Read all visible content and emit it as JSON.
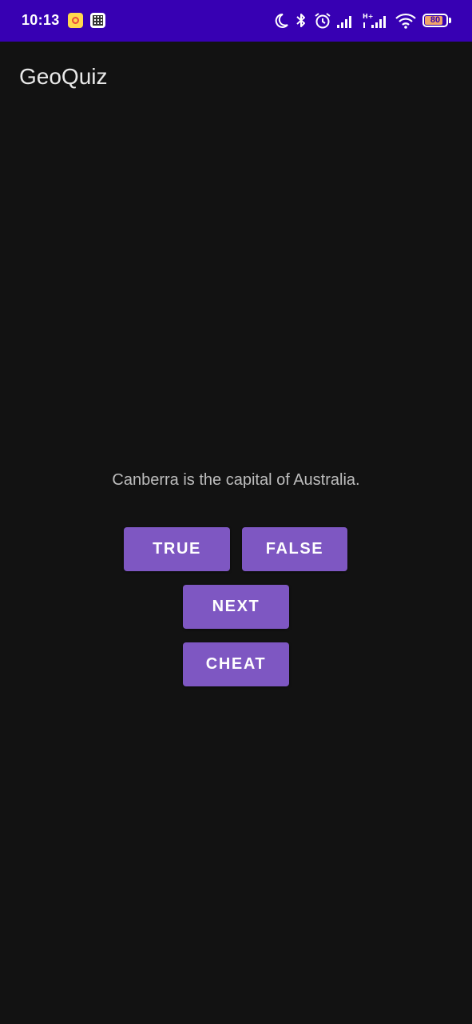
{
  "status_bar": {
    "time": "10:13",
    "battery_level": "80",
    "background_color": "#3700b3",
    "icons": [
      "app-notification-icon",
      "qr-notification-icon",
      "moon-icon",
      "bluetooth-icon",
      "alarm-icon",
      "signal-icon",
      "signal-hplus-icon",
      "wifi-icon",
      "battery-icon"
    ]
  },
  "app_bar": {
    "title": "GeoQuiz"
  },
  "quiz": {
    "question": "Canberra is the capital of Australia.",
    "true_label": "TRUE",
    "false_label": "FALSE",
    "next_label": "NEXT",
    "cheat_label": "CHEAT"
  },
  "colors": {
    "background": "#121212",
    "button": "#7e57c2",
    "question_text": "#bdbdbd"
  }
}
